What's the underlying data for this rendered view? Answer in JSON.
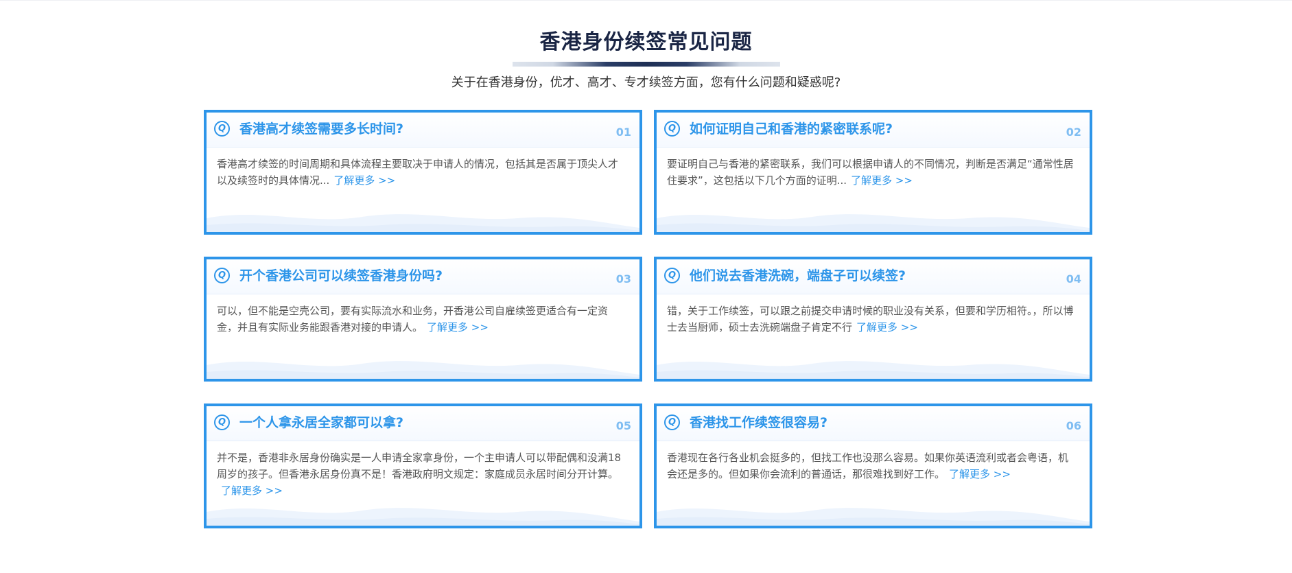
{
  "header": {
    "title": "香港身份续签常见问题",
    "subtitle": "关于在香港身份，优才、高才、专才续签方面，您有什么问题和疑惑呢?"
  },
  "faq": {
    "more_label": "了解更多 >>",
    "items": [
      {
        "num": "01",
        "question": "香港高才续签需要多长时间?",
        "answer": "香港高才续签的时间周期和具体流程主要取决于申请人的情况，包括其是否属于顶尖人才以及续签时的具体情况..."
      },
      {
        "num": "02",
        "question": "如何证明自己和香港的紧密联系呢?",
        "answer": "要证明自己与香港的紧密联系，我们可以根据申请人的不同情况，判断是否满足“通常性居住要求”，这包括以下几个方面的证明..."
      },
      {
        "num": "03",
        "question": "开个香港公司可以续签香港身份吗?",
        "answer": "可以，但不能是空壳公司，要有实际流水和业务，开香港公司自雇续签更适合有一定资金，并且有实际业务能跟香港对接的申请人。"
      },
      {
        "num": "04",
        "question": "他们说去香港洗碗，端盘子可以续签?",
        "answer": "错，关于工作续签，可以跟之前提交申请时候的职业没有关系，但要和学历相符。，所以博士去当厨师，硕士去洗碗端盘子肯定不行"
      },
      {
        "num": "05",
        "question": "一个人拿永居全家都可以拿?",
        "answer": "并不是，香港非永居身份确实是一人申请全家拿身份，一个主申请人可以带配偶和没满18周岁的孩子。但香港永居身份真不是！香港政府明文规定：家庭成员永居时间分开计算。"
      },
      {
        "num": "06",
        "question": "香港找工作续签很容易?",
        "answer": "香港现在各行各业机会挺多的，但找工作也没那么容易。如果你英语流利或者会粤语，机会还是多的。但如果你会流利的普通话，那很难找到好工作。"
      }
    ]
  },
  "colors": {
    "accent": "#2d95e9",
    "title": "#1a2544",
    "text": "#555555"
  }
}
